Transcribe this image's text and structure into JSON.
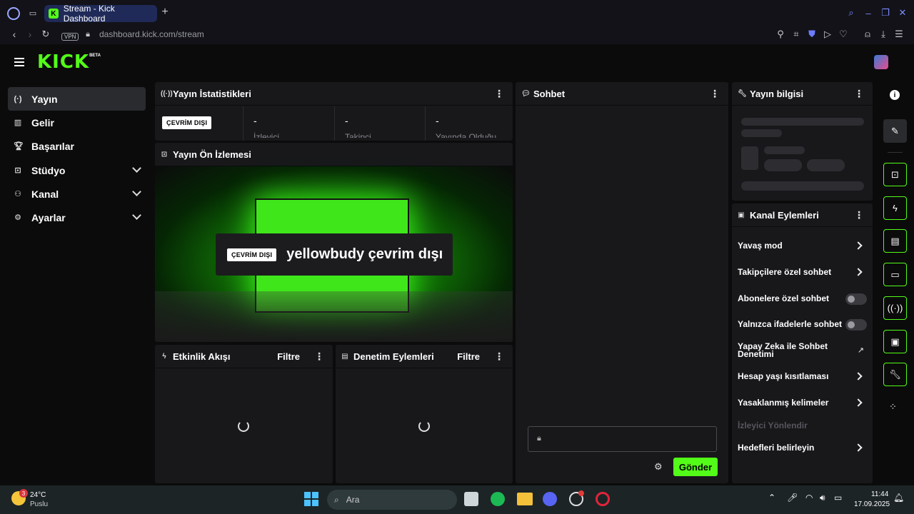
{
  "browser": {
    "tab_title": "Stream - Kick Dashboard",
    "vpn_label": "VPN",
    "url": "dashboard.kick.com/stream"
  },
  "header": {
    "logo": "KICK",
    "beta": "BETA"
  },
  "sidebar": {
    "items": [
      {
        "label": "Yayın"
      },
      {
        "label": "Gelir"
      },
      {
        "label": "Başarılar"
      },
      {
        "label": "Stüdyo"
      },
      {
        "label": "Kanal"
      },
      {
        "label": "Ayarlar"
      }
    ]
  },
  "stats": {
    "title": "Yayın İstatistikleri",
    "status_badge": "ÇEVRİM DIŞI",
    "cells": [
      {
        "value": "-",
        "label": "İzleyici"
      },
      {
        "value": "-",
        "label": "Takipçi"
      },
      {
        "value": "-",
        "label": "Yayında Olduğu"
      }
    ]
  },
  "preview": {
    "title": "Yayın Ön İzlemesi",
    "badge": "ÇEVRİM DIŞI",
    "message": "yellowbudy çevrim dışı"
  },
  "activity": {
    "title": "Etkinlik Akışı",
    "filter": "Filtre"
  },
  "moderation": {
    "title": "Denetim Eylemleri",
    "filter": "Filtre"
  },
  "chat": {
    "title": "Sohbet",
    "send": "Gönder"
  },
  "info": {
    "title": "Yayın bilgisi"
  },
  "channel_actions": {
    "title": "Kanal Eylemleri",
    "items": [
      {
        "label": "Yavaş mod"
      },
      {
        "label": "Takipçilere özel sohbet"
      },
      {
        "label": "Abonelere özel sohbet"
      },
      {
        "label": "Yalnızca ifadelerle sohbet"
      },
      {
        "label": "Yapay Zeka ile Sohbet Denetimi"
      },
      {
        "label": "Hesap yaşı kısıtlaması"
      },
      {
        "label": "Yasaklanmış kelimeler"
      },
      {
        "label": "İzleyici Yönlendir"
      },
      {
        "label": "Hedefleri belirleyin"
      }
    ]
  },
  "taskbar": {
    "weather_temp": "24°C",
    "weather_desc": "Puslu",
    "weather_badge": "3",
    "search": "Ara",
    "time": "11:44",
    "date": "17.09.2025"
  }
}
